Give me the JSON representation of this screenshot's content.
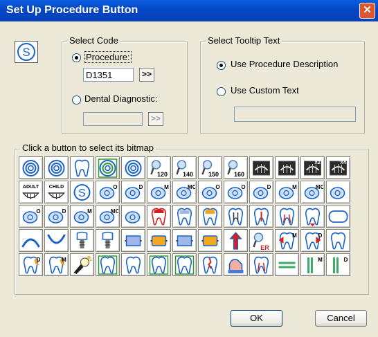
{
  "window": {
    "title": "Set Up Procedure Button",
    "close_label": "✕"
  },
  "select_code": {
    "legend": "Select Code",
    "procedure_label": "Procedure:",
    "procedure_value": "D1351",
    "procedure_selected": true,
    "browse_label": ">>",
    "dental_diagnostic_label": "Dental Diagnostic:",
    "dental_diagnostic_value": "",
    "dental_browse_label": ">>"
  },
  "select_tooltip": {
    "legend": "Select Tooltip Text",
    "use_description_label": "Use Procedure Description",
    "use_description_selected": true,
    "use_custom_label": "Use Custom Text",
    "custom_text_value": ""
  },
  "bitmaps": {
    "legend": "Click a button to select its bitmap",
    "cells": [
      {
        "icon": "ring-icon"
      },
      {
        "icon": "ring-icon"
      },
      {
        "icon": "tooth-outline-icon"
      },
      {
        "icon": "ring-green-icon"
      },
      {
        "icon": "ring-icon"
      },
      {
        "icon": "magnifier-icon",
        "label": "120"
      },
      {
        "icon": "magnifier-icon",
        "label": "140"
      },
      {
        "icon": "magnifier-icon",
        "label": "150"
      },
      {
        "icon": "magnifier-icon",
        "label": "160"
      },
      {
        "icon": "xray-icon"
      },
      {
        "icon": "xray-icon"
      },
      {
        "icon": "xray-icon",
        "label": "X2"
      },
      {
        "icon": "xray-icon",
        "label": "X4"
      },
      {
        "icon": "teeth-icon",
        "label": "ADULT"
      },
      {
        "icon": "teeth-icon",
        "label": "CHILD"
      },
      {
        "icon": "s-circle-icon"
      },
      {
        "icon": "crown-icon",
        "label": "O"
      },
      {
        "icon": "crown-icon",
        "label": "D"
      },
      {
        "icon": "crown-icon",
        "label": "M"
      },
      {
        "icon": "crown-icon",
        "label": "MO"
      },
      {
        "icon": "crown-icon",
        "label": "O"
      },
      {
        "icon": "crown-icon",
        "label": "O"
      },
      {
        "icon": "crown-icon",
        "label": "D"
      },
      {
        "icon": "crown-icon",
        "label": "M"
      },
      {
        "icon": "crown-icon",
        "label": "MO"
      },
      {
        "icon": "crown-icon"
      },
      {
        "icon": "crown-icon",
        "label": "O"
      },
      {
        "icon": "crown-icon",
        "label": "D"
      },
      {
        "icon": "crown-icon",
        "label": "M"
      },
      {
        "icon": "crown-icon",
        "label": "MO"
      },
      {
        "icon": "crown-icon"
      },
      {
        "icon": "tooth-red-icon"
      },
      {
        "icon": "tooth-hatched-icon"
      },
      {
        "icon": "tooth-yellow-icon"
      },
      {
        "icon": "tooth-pin-icon"
      },
      {
        "icon": "tooth-post-icon"
      },
      {
        "icon": "tooth-root-icon"
      },
      {
        "icon": "tooth-arrow-icon"
      },
      {
        "icon": "rounded-rect-icon"
      },
      {
        "icon": "arch-upper-icon"
      },
      {
        "icon": "arch-lower-icon"
      },
      {
        "icon": "tooth-implant-icon"
      },
      {
        "icon": "tooth-implant-icon"
      },
      {
        "icon": "bridge-hatched-icon"
      },
      {
        "icon": "bridge-yellow-icon"
      },
      {
        "icon": "bridge-hatched-icon"
      },
      {
        "icon": "bridge-yellow-icon"
      },
      {
        "icon": "arrow-up-icon"
      },
      {
        "icon": "magnifier-icon",
        "label": "ER"
      },
      {
        "icon": "tooth-mesial-icon",
        "label": "M"
      },
      {
        "icon": "tooth-distal-icon",
        "label": "D"
      },
      {
        "icon": "tooth-outline-icon"
      },
      {
        "icon": "tooth-burst-icon",
        "label": "D"
      },
      {
        "icon": "tooth-burst-icon",
        "label": "M"
      },
      {
        "icon": "flashlight-icon"
      },
      {
        "icon": "tooth-green-frame-icon"
      },
      {
        "icon": "tooth-outline-icon"
      },
      {
        "icon": "tooth-green-frame-icon"
      },
      {
        "icon": "tooth-green-frame-icon"
      },
      {
        "icon": "tooth-fracture-icon"
      },
      {
        "icon": "tooth-cavity-icon"
      },
      {
        "icon": "tooth-root-icon"
      },
      {
        "icon": "equals-icon"
      },
      {
        "icon": "parallel-lines-icon",
        "label": "M"
      },
      {
        "icon": "parallel-lines-icon",
        "label": "D"
      }
    ]
  },
  "buttons": {
    "ok_label": "OK",
    "cancel_label": "Cancel"
  },
  "colors": {
    "title_bar": "#0A5FE0",
    "window_bg": "#ECE9D8",
    "icon_blue": "#1B63C6",
    "icon_green": "#2E9E2E",
    "icon_red": "#D42020",
    "icon_yellow": "#F2A820"
  }
}
